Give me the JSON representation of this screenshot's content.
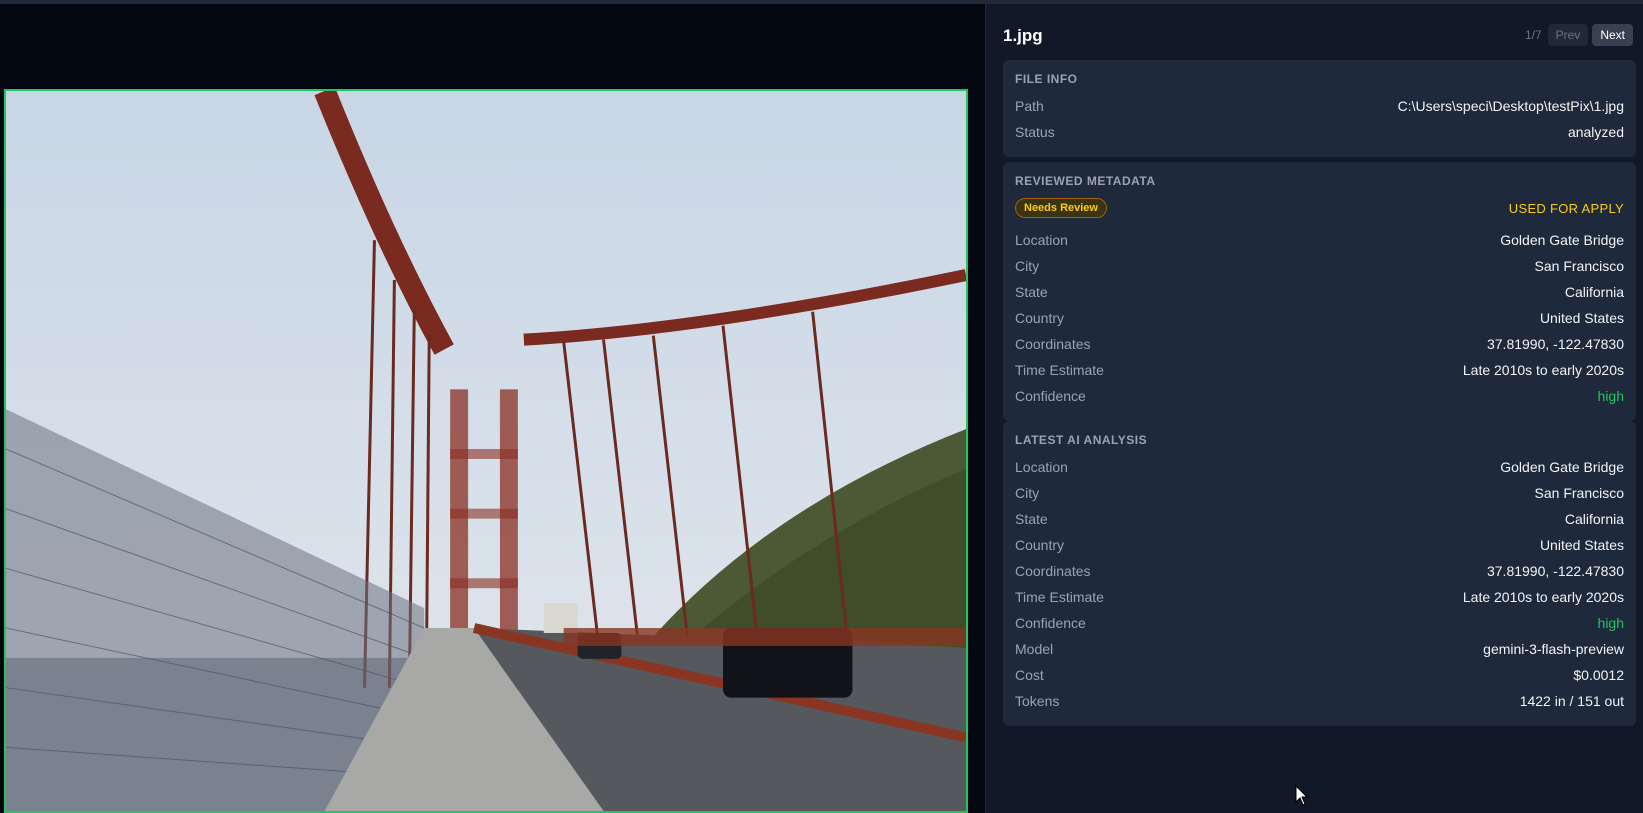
{
  "file": {
    "name": "1.jpg",
    "counter": "1/7",
    "prev_label": "Prev",
    "next_label": "Next"
  },
  "file_info": {
    "title": "FILE INFO",
    "rows": [
      {
        "key": "Path",
        "value": "C:\\Users\\speci\\Desktop\\testPix\\1.jpg"
      },
      {
        "key": "Status",
        "value": "analyzed"
      }
    ]
  },
  "reviewed": {
    "title": "REVIEWED METADATA",
    "badge": "Needs Review",
    "used_label": "USED FOR APPLY",
    "rows": [
      {
        "key": "Location",
        "value": "Golden Gate Bridge"
      },
      {
        "key": "City",
        "value": "San Francisco"
      },
      {
        "key": "State",
        "value": "California"
      },
      {
        "key": "Country",
        "value": "United States"
      },
      {
        "key": "Coordinates",
        "value": "37.81990, -122.47830"
      },
      {
        "key": "Time Estimate",
        "value": "Late 2010s to early 2020s"
      },
      {
        "key": "Confidence",
        "value": "high"
      }
    ]
  },
  "analysis": {
    "title": "LATEST AI ANALYSIS",
    "rows": [
      {
        "key": "Location",
        "value": "Golden Gate Bridge"
      },
      {
        "key": "City",
        "value": "San Francisco"
      },
      {
        "key": "State",
        "value": "California"
      },
      {
        "key": "Country",
        "value": "United States"
      },
      {
        "key": "Coordinates",
        "value": "37.81990, -122.47830"
      },
      {
        "key": "Time Estimate",
        "value": "Late 2010s to early 2020s"
      },
      {
        "key": "Confidence",
        "value": "high"
      },
      {
        "key": "Model",
        "value": "gemini-3-flash-preview"
      },
      {
        "key": "Cost",
        "value": "$0.0012"
      },
      {
        "key": "Tokens",
        "value": "1422 in / 151 out"
      }
    ]
  },
  "colors": {
    "accent_green": "#22c55e",
    "warning_yellow": "#facc15",
    "panel_bg": "#111827",
    "card_bg": "#1e293b"
  }
}
